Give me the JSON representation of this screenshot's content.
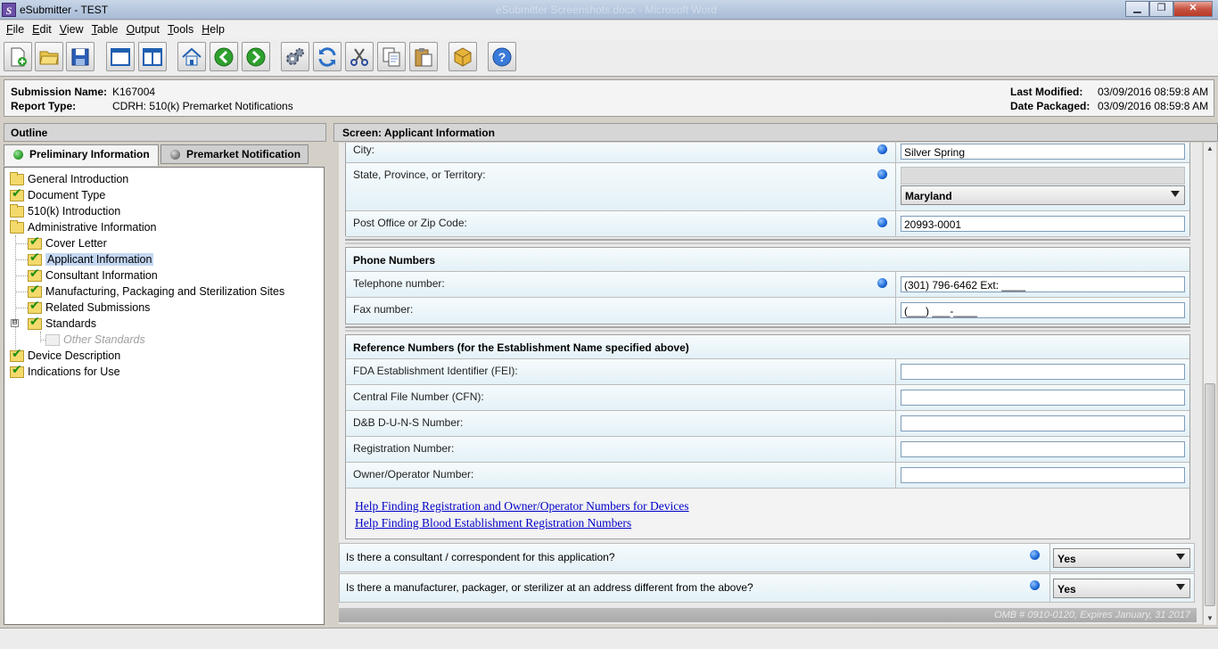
{
  "window": {
    "app_title": "eSubmitter - TEST",
    "center_title": "eSubmitter Screenshots.docx - Microsoft Word"
  },
  "menu": [
    "File",
    "Edit",
    "View",
    "Table",
    "Output",
    "Tools",
    "Help"
  ],
  "menu_mnemonics": [
    "F",
    "E",
    "V",
    "T",
    "O",
    "T",
    "H"
  ],
  "toolbar": [
    "new-document",
    "open-folder",
    "save-disk",
    "window-single",
    "window-split",
    "home",
    "back-arrow",
    "forward-arrow",
    "settings-gears",
    "refresh",
    "cut-scissors",
    "copy",
    "paste",
    "package-box",
    "help"
  ],
  "submission": {
    "name_label": "Submission Name:",
    "name": "K167004",
    "type_label": "Report Type:",
    "type": "CDRH: 510(k) Premarket Notifications",
    "modified_label": "Last Modified:",
    "modified": "03/09/2016 08:59:8 AM",
    "packaged_label": "Date Packaged:",
    "packaged": "03/09/2016 08:59:8 AM"
  },
  "outline": {
    "title": "Outline",
    "tabs": [
      {
        "label": "Preliminary Information",
        "status_color": "#2ea02e"
      },
      {
        "label": "Premarket Notification",
        "status_color": "#707070"
      }
    ],
    "items": [
      {
        "label": "General Introduction",
        "icon": "folder",
        "level": 0
      },
      {
        "label": "Document Type",
        "icon": "check-folder",
        "level": 0
      },
      {
        "label": "510(k) Introduction",
        "icon": "folder",
        "level": 0
      },
      {
        "label": "Administrative Information",
        "icon": "folder",
        "level": 0
      },
      {
        "label": "Cover Letter",
        "icon": "check-folder",
        "level": 1
      },
      {
        "label": "Applicant Information",
        "icon": "check-folder",
        "level": 1,
        "selected": true
      },
      {
        "label": "Consultant Information",
        "icon": "check-folder",
        "level": 1
      },
      {
        "label": "Manufacturing, Packaging and Sterilization Sites",
        "icon": "check-folder",
        "level": 1
      },
      {
        "label": "Related Submissions",
        "icon": "check-folder",
        "level": 1
      },
      {
        "label": "Standards",
        "icon": "check-folder",
        "level": 1,
        "expander": "⊟"
      },
      {
        "label": "Other Standards",
        "icon": "ghost-folder",
        "level": 2,
        "disabled": true
      },
      {
        "label": "Device Description",
        "icon": "check-folder",
        "level": 0
      },
      {
        "label": "Indications for Use",
        "icon": "check-folder",
        "level": 0
      }
    ]
  },
  "screen": {
    "title": "Screen: Applicant Information",
    "address": {
      "city_label": "City:",
      "city_value": "Silver Spring",
      "state_label": "State, Province, or Territory:",
      "state_value": "Maryland",
      "zip_label": "Post Office or Zip Code:",
      "zip_value": "20993-0001"
    },
    "phone": {
      "title": "Phone Numbers",
      "telephone_label": "Telephone number:",
      "telephone_value": "(301) 796-6462 Ext: ____",
      "fax_label": "Fax number:",
      "fax_value": "(___) ___-____"
    },
    "reference": {
      "title": "Reference Numbers (for the Establishment Name specified above)",
      "fields": [
        {
          "label": "FDA Establishment Identifier (FEI):",
          "value": ""
        },
        {
          "label": "Central File Number (CFN):",
          "value": ""
        },
        {
          "label": "D&B D-U-N-S Number:",
          "value": ""
        },
        {
          "label": "Registration Number:",
          "value": ""
        },
        {
          "label": "Owner/Operator Number:",
          "value": ""
        }
      ],
      "links": [
        "Help Finding Registration and Owner/Operator Numbers for Devices",
        "Help Finding Blood Establishment Registration Numbers"
      ]
    },
    "questions": [
      {
        "label": "Is there a consultant / correspondent for this application?",
        "value": "Yes"
      },
      {
        "label": "Is there a manufacturer, packager, or sterilizer at an address different from the above?",
        "value": "Yes"
      }
    ],
    "footer": "OMB # 0910-0120, Expires January, 31 2017"
  },
  "colors": {
    "required_dot": "#1a66d6",
    "link": "#0000c8",
    "selected": "#c4d7f2",
    "row_bg": "#e3f1f7"
  }
}
